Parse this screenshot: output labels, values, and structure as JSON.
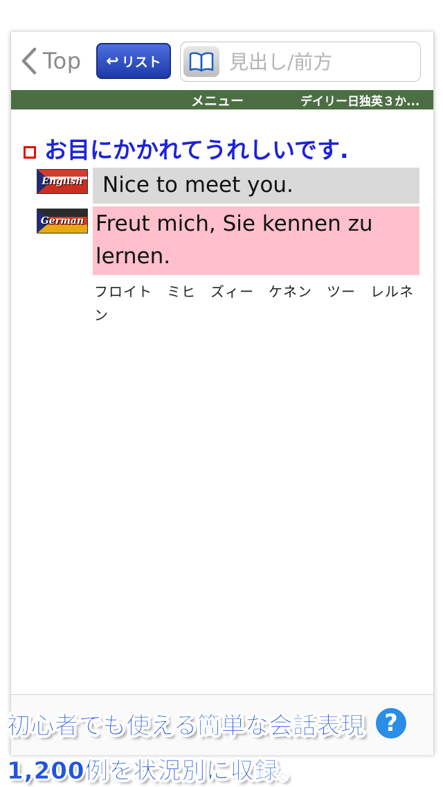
{
  "navbar": {
    "back_label": "Top",
    "list_button_label": "リスト",
    "search_placeholder": "見出し/前方",
    "search_value": ""
  },
  "menubar": {
    "menu_label": "メニュー",
    "daily_label": "デイリー日独英３か..."
  },
  "entry": {
    "japanese": "お目にかかれてうれしいです.",
    "english_flag_text": "English",
    "english": "Nice to meet you.",
    "german_flag_text": "German",
    "german": "Freut mich, Sie kennen zu lernen.",
    "pronunciation": "フロイト　ミヒ　ズィー　ケネン　ツー　レルネン"
  },
  "promo": {
    "line1": "初心者でも使える簡単な会話表現",
    "line2": "1,200例を状況別に収録。",
    "help_label": "?"
  },
  "colors": {
    "menubar": "#4c6e43",
    "japanese_text": "#1d23d8",
    "english_bg": "#d9d9d9",
    "german_bg": "#ffc0cb",
    "bullet": "#e01010",
    "caption": "#2255dd"
  }
}
